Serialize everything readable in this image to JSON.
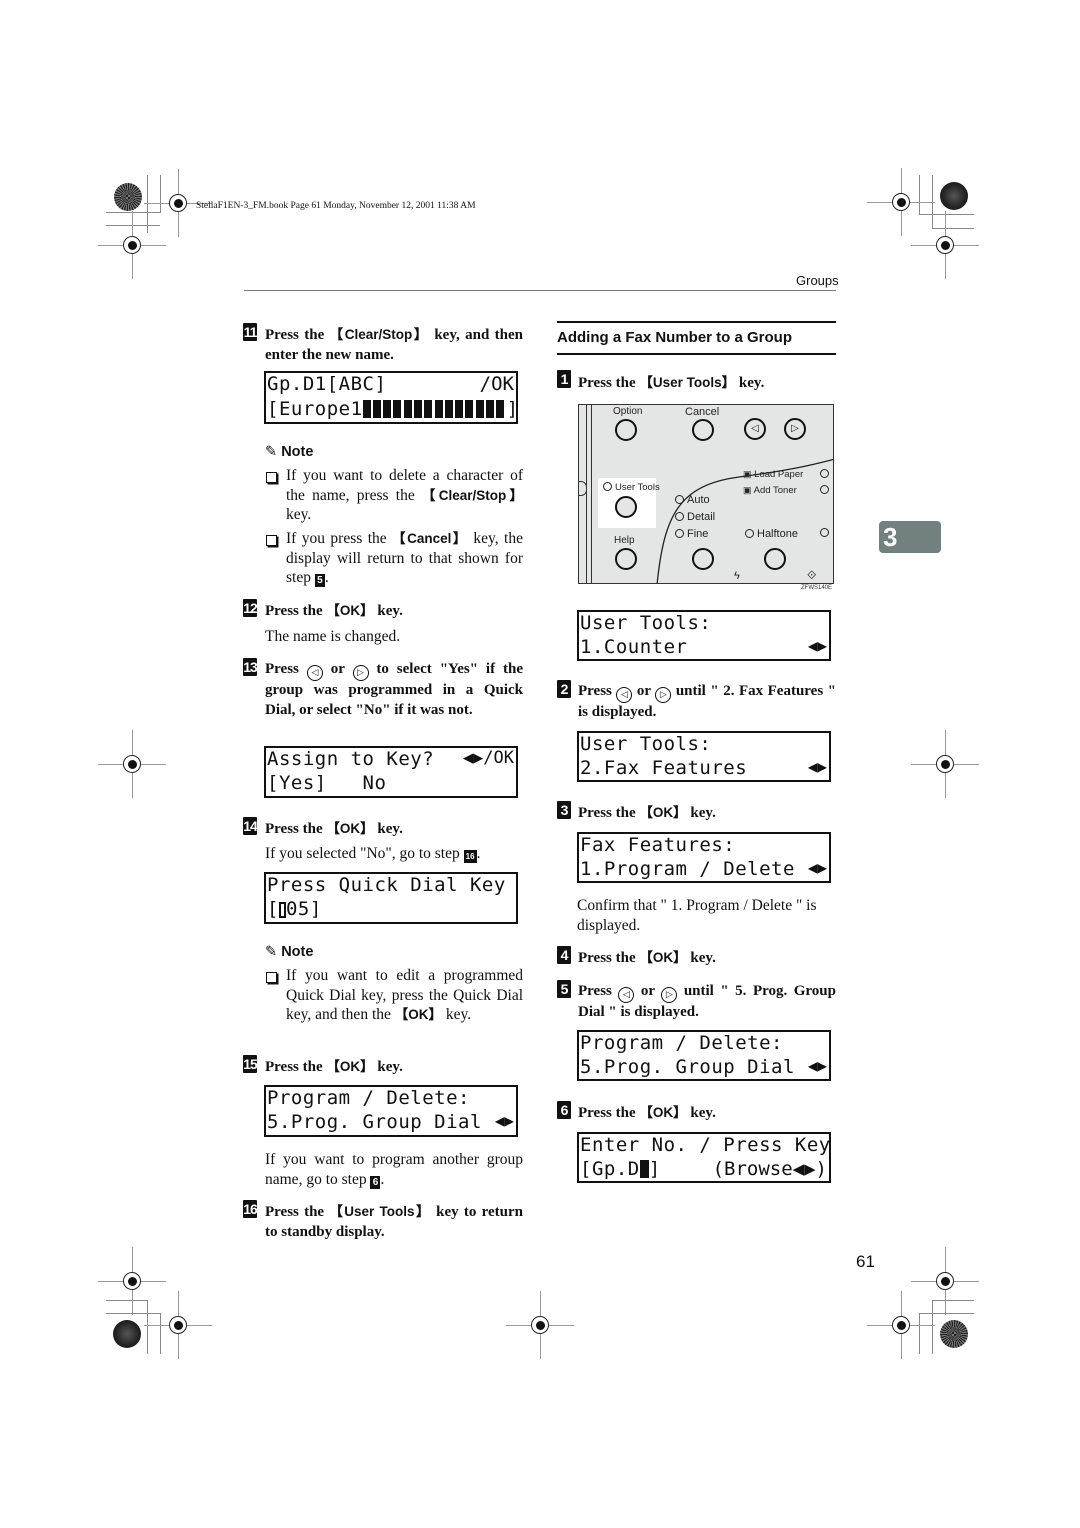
{
  "print_header": "StellaF1EN-3_FM.book  Page 61  Monday, November 12, 2001  11:38 AM",
  "running_head": "Groups",
  "chapter_tab": "3",
  "page_number": "61",
  "left_column": {
    "step11": {
      "num": "11",
      "text_a": "Press the ",
      "key": "【Clear/Stop】",
      "text_b": " key, and then enter the new name.",
      "lcd": {
        "line1": "Gp.D1[ABC]",
        "line1_right": "/OK",
        "line2_prefix": "[Europe1",
        "line2_suffix": "]",
        "filled_blocks": 14
      }
    },
    "note1": {
      "title": "Note",
      "items": [
        {
          "text_a": "If you want to delete a character of the name, press the ",
          "key": "【Clear/Stop】",
          "text_b": " key."
        },
        {
          "text_a": "If you press the ",
          "key": "【Cancel】",
          "text_b": " key, the display will return to that shown for step ",
          "step_ref": "5",
          "text_c": "."
        }
      ]
    },
    "step12": {
      "num": "12",
      "text_a": "Press the ",
      "key": "【OK】",
      "text_b": " key.",
      "body": "The name is changed."
    },
    "step13": {
      "num": "13",
      "text": "Press ◁ or ▷ to select \"Yes\" if the group was programmed in a Quick Dial, or select \"No\" if it was not.",
      "text_a": "Press ",
      "text_or": " or ",
      "text_b": " to select \"Yes\" if the group was programmed in a Quick Dial, or select \"No\" if it was not.",
      "lcd": {
        "line1": "Assign to Key?",
        "line1_right": "◀▶/OK",
        "line2": "[Yes]   No"
      }
    },
    "step14": {
      "num": "14",
      "text_a": "Press the ",
      "key": "【OK】",
      "text_b": " key.",
      "body_a": "If you selected \"No\", go to step ",
      "body_ref": "16",
      "body_b": ".",
      "lcd": {
        "line1": "Press Quick Dial Key",
        "line2_prefix": "[",
        "line2_cursor": "0",
        "line2_suffix": "05]"
      }
    },
    "note2": {
      "title": "Note",
      "items": [
        {
          "text_a": "If you want to edit a programmed Quick Dial key, press the Quick Dial key, and then the ",
          "key": "【OK】",
          "text_b": " key."
        }
      ]
    },
    "step15": {
      "num": "15",
      "text_a": "Press the ",
      "key": "【OK】",
      "text_b": " key.",
      "lcd": {
        "line1": "Program / Delete:",
        "line2": "5.Prog. Group Dial",
        "line2_right": "◀▶"
      },
      "body_a": "If you want to program another group name, go to step ",
      "body_ref": "6",
      "body_b": "."
    },
    "step16": {
      "num": "16",
      "text_a": "Press the ",
      "key": "【User Tools】",
      "text_b": " key to return to standby display."
    }
  },
  "right_column": {
    "section_title": "Adding a Fax Number to a Group",
    "step1": {
      "num": "1",
      "text_a": "Press the ",
      "key": "【User Tools】",
      "text_b": " key."
    },
    "panel": {
      "labels": {
        "option": "Option",
        "cancel": "Cancel",
        "user_tools": "User Tools",
        "help": "Help",
        "auto": "Auto",
        "detail": "Detail",
        "fine": "Fine",
        "halftone": "Halftone",
        "load_paper": "Load Paper",
        "add_toner": "Add Toner",
        "figure_code": "ZFWS140E"
      }
    },
    "lcd_user_tools_1": {
      "line1": "User Tools:",
      "line2": "1.Counter",
      "line2_right": "◀▶"
    },
    "step2": {
      "num": "2",
      "text_a": "Press ",
      "text_or": " or ",
      "text_b": " until \" 2. Fax Features \" is displayed."
    },
    "lcd_user_tools_2": {
      "line1": "User Tools:",
      "line2": "2.Fax Features",
      "line2_right": "◀▶"
    },
    "step3": {
      "num": "3",
      "text_a": "Press the ",
      "key": "【OK】",
      "text_b": " key.",
      "lcd": {
        "line1": "Fax Features:",
        "line2": "1.Program / Delete",
        "line2_right": "◀▶"
      },
      "body": "Confirm that \" 1. Program / Delete \" is displayed."
    },
    "step4": {
      "num": "4",
      "text_a": "Press the ",
      "key": "【OK】",
      "text_b": " key."
    },
    "step5": {
      "num": "5",
      "text_a": "Press ",
      "text_or": " or ",
      "text_b": " until \" 5. Prog. Group Dial \" is displayed.",
      "lcd": {
        "line1": "Program / Delete:",
        "line2": "5.Prog. Group Dial",
        "line2_right": "◀▶"
      }
    },
    "step6": {
      "num": "6",
      "text_a": "Press the ",
      "key": "【OK】",
      "text_b": " key.",
      "lcd": {
        "line1": "Enter No. / Press Key",
        "line2_prefix": "[Gp.D",
        "line2_suffix": "]",
        "line2_right": "(Browse◀▶)"
      }
    }
  },
  "icons": {
    "left_key": "◁",
    "right_key": "▷",
    "note": "✎",
    "bullet": "checkbox-bullet"
  }
}
